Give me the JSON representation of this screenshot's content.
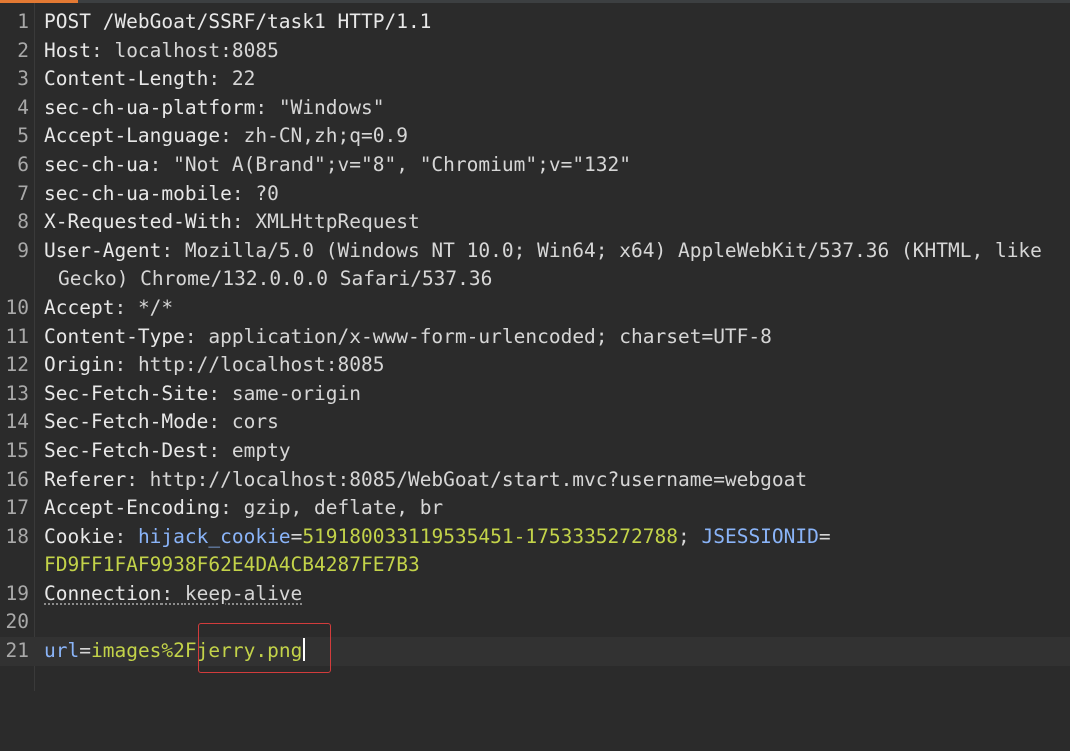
{
  "request_line": "POST /WebGoat/SSRF/task1 HTTP/1.1",
  "headers": [
    {
      "n": "2",
      "name": "Host",
      "value": "localhost:8085"
    },
    {
      "n": "3",
      "name": "Content-Length",
      "value": "22"
    },
    {
      "n": "4",
      "name": "sec-ch-ua-platform",
      "value": "\"Windows\""
    },
    {
      "n": "5",
      "name": "Accept-Language",
      "value": "zh-CN,zh;q=0.9"
    },
    {
      "n": "6",
      "name": "sec-ch-ua",
      "value": "\"Not A(Brand\";v=\"8\", \"Chromium\";v=\"132\""
    },
    {
      "n": "7",
      "name": "sec-ch-ua-mobile",
      "value": "?0"
    },
    {
      "n": "8",
      "name": "X-Requested-With",
      "value": "XMLHttpRequest"
    },
    {
      "n": "9",
      "name": "User-Agent",
      "value": "Mozilla/5.0 (Windows NT 10.0; Win64; x64) AppleWebKit/537.36 (KHTML, like",
      "value_wrap": "Gecko) Chrome/132.0.0.0 Safari/537.36"
    },
    {
      "n": "10",
      "name": "Accept",
      "value": "*/*"
    },
    {
      "n": "11",
      "name": "Content-Type",
      "value": "application/x-www-form-urlencoded; charset=UTF-8"
    },
    {
      "n": "12",
      "name": "Origin",
      "value": "http://localhost:8085"
    },
    {
      "n": "13",
      "name": "Sec-Fetch-Site",
      "value": "same-origin"
    },
    {
      "n": "14",
      "name": "Sec-Fetch-Mode",
      "value": "cors"
    },
    {
      "n": "15",
      "name": "Sec-Fetch-Dest",
      "value": "empty"
    },
    {
      "n": "16",
      "name": "Referer",
      "value": "http://localhost:8085/WebGoat/start.mvc?username=webgoat"
    },
    {
      "n": "17",
      "name": "Accept-Encoding",
      "value": "gzip, deflate, br"
    }
  ],
  "cookie": {
    "n": "18",
    "name": "Cookie",
    "c1_name": "hijack_cookie",
    "c1_value": "5191800331195354 51-1753335272788",
    "c2_name": "JSESSIONID",
    "c2_value": "FD9FF1FAF9938F62E4DA4CB4287FE7B3"
  },
  "connection": {
    "n": "19",
    "name": "Connection",
    "value": "keep-alive"
  },
  "blank_line": {
    "n": "20"
  },
  "body": {
    "n": "21",
    "key": "url",
    "eq": "=",
    "value": "images%2Fjerry.png"
  },
  "line1_n": "1",
  "colors": {
    "accent": "#e37933",
    "highlight_box": "#d23c3c",
    "cookie_value": "#c3d349",
    "param_key": "#8ab4f8"
  }
}
